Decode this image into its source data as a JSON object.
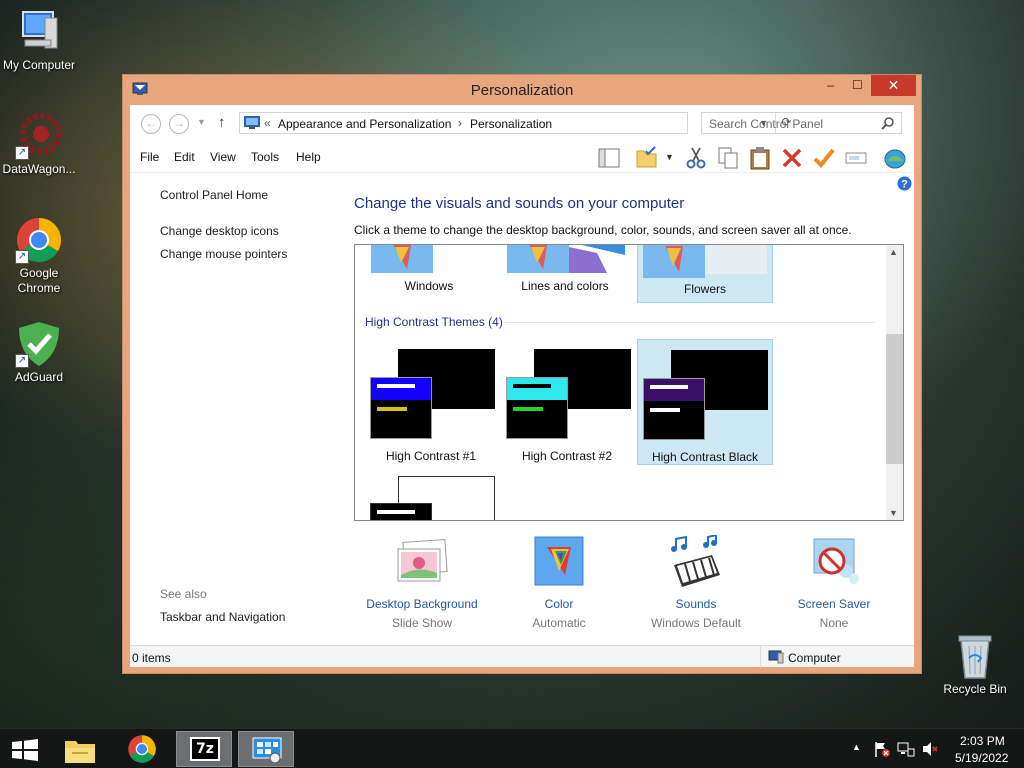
{
  "desktop": {
    "icons": [
      {
        "label": "My Computer",
        "icon": "computer-icon"
      },
      {
        "label": "DataWagon...",
        "icon": "datawagon-icon"
      },
      {
        "label": "Google Chrome",
        "icon": "chrome-icon"
      },
      {
        "label": "AdGuard",
        "icon": "adguard-icon"
      },
      {
        "label": "Recycle Bin",
        "icon": "recycle-bin-icon"
      }
    ]
  },
  "window": {
    "title": "Personalization",
    "controls": {
      "minimize": "–",
      "maximize": "☐",
      "close": "✕"
    },
    "address": {
      "prefix": "«",
      "crumbs": [
        "Appearance and Personalization",
        "Personalization"
      ],
      "separator": "›"
    },
    "search": {
      "placeholder": "Search Control Panel"
    },
    "menu": [
      "File",
      "Edit",
      "View",
      "Tools",
      "Help"
    ],
    "left_pane": {
      "home": "Control Panel Home",
      "links": [
        "Change desktop icons",
        "Change mouse pointers"
      ],
      "see_also_title": "See also",
      "see_also": [
        "Taskbar and Navigation"
      ]
    },
    "main": {
      "heading": "Change the visuals and sounds on your computer",
      "subheading": "Click a theme to change the desktop background, color, sounds, and screen saver all at once.",
      "themes_top": [
        "Windows",
        "Lines and colors",
        "Flowers"
      ],
      "group_title": "High Contrast Themes (4)",
      "high_contrast": [
        "High Contrast #1",
        "High Contrast #2",
        "High Contrast Black"
      ],
      "selected": "High Contrast Black"
    },
    "bottom": [
      {
        "label": "Desktop Background",
        "value": "Slide Show"
      },
      {
        "label": "Color",
        "value": "Automatic"
      },
      {
        "label": "Sounds",
        "value": "Windows Default"
      },
      {
        "label": "Screen Saver",
        "value": "None"
      }
    ],
    "status": {
      "items": "0 items",
      "location": "Computer"
    }
  },
  "taskbar": {
    "time": "2:03 PM",
    "date": "5/19/2022",
    "apps": [
      "start-icon",
      "file-explorer-icon",
      "chrome-icon",
      "7zip-icon",
      "control-panel-icon"
    ]
  },
  "colors": {
    "window_frame": "#e8a67e",
    "close_button": "#c7392b",
    "link_blue": "#1e5aa0",
    "heading_blue": "#1e3287",
    "selection": "#cce8f3"
  }
}
